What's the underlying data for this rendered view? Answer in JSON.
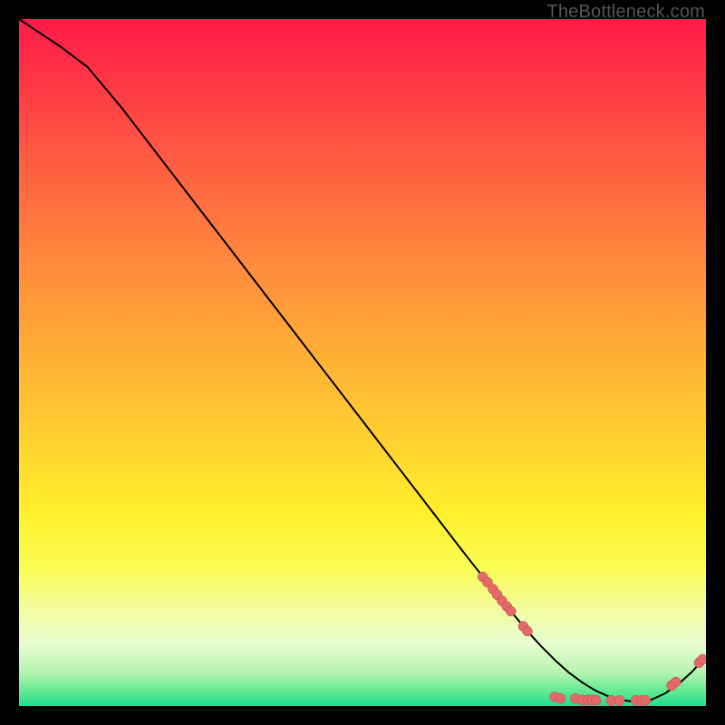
{
  "watermark": "TheBottleneck.com",
  "colors": {
    "curve": "#000000",
    "dot_fill": "#e46a6a",
    "dot_stroke": "#c24a4a"
  },
  "chart_data": {
    "type": "line",
    "title": "",
    "xlabel": "",
    "ylabel": "",
    "xlim": [
      0,
      100
    ],
    "ylim": [
      0,
      100
    ],
    "grid": false,
    "legend": false,
    "series": [
      {
        "name": "curve",
        "x": [
          0,
          3,
          6,
          10,
          15,
          20,
          25,
          30,
          35,
          40,
          45,
          50,
          55,
          60,
          65,
          68,
          70,
          72,
          74,
          76,
          78,
          80,
          82,
          84,
          86,
          88,
          90,
          92,
          94,
          96,
          98,
          100
        ],
        "values": [
          100,
          98,
          96,
          93,
          87,
          80.5,
          74,
          67.5,
          61,
          54.5,
          48,
          41.5,
          35,
          28.5,
          22,
          18.2,
          15.7,
          13.3,
          10.9,
          8.7,
          6.7,
          4.9,
          3.4,
          2.2,
          1.3,
          0.8,
          0.6,
          0.9,
          1.8,
          3.2,
          5.0,
          7.2
        ]
      }
    ],
    "points": [
      {
        "name": "dot-cluster-left",
        "x": 67.5,
        "y": 18.8
      },
      {
        "name": "dot-cluster-left",
        "x": 68.2,
        "y": 18.0
      },
      {
        "name": "dot-cluster-left",
        "x": 69.0,
        "y": 17.0
      },
      {
        "name": "dot-cluster-left",
        "x": 69.6,
        "y": 16.2
      },
      {
        "name": "dot-cluster-left",
        "x": 70.3,
        "y": 15.3
      },
      {
        "name": "dot-cluster-left",
        "x": 71.0,
        "y": 14.5
      },
      {
        "name": "dot-cluster-left",
        "x": 71.6,
        "y": 13.8
      },
      {
        "name": "dot-cluster-left",
        "x": 73.4,
        "y": 11.6
      },
      {
        "name": "dot-cluster-left",
        "x": 74.0,
        "y": 10.9
      },
      {
        "name": "dot-bottom",
        "x": 78.0,
        "y": 1.3
      },
      {
        "name": "dot-bottom",
        "x": 78.8,
        "y": 1.1
      },
      {
        "name": "dot-bottom",
        "x": 81.0,
        "y": 1.1
      },
      {
        "name": "dot-bottom",
        "x": 82.0,
        "y": 0.9
      },
      {
        "name": "dot-bottom",
        "x": 82.8,
        "y": 0.9
      },
      {
        "name": "dot-bottom",
        "x": 83.4,
        "y": 0.9
      },
      {
        "name": "dot-bottom",
        "x": 84.0,
        "y": 0.85
      },
      {
        "name": "dot-bottom",
        "x": 86.2,
        "y": 0.8
      },
      {
        "name": "dot-bottom",
        "x": 87.4,
        "y": 0.8
      },
      {
        "name": "dot-bottom",
        "x": 89.8,
        "y": 0.8
      },
      {
        "name": "dot-bottom",
        "x": 90.6,
        "y": 0.8
      },
      {
        "name": "dot-bottom",
        "x": 91.2,
        "y": 0.8
      },
      {
        "name": "dot-right-rise",
        "x": 95.0,
        "y": 3.0
      },
      {
        "name": "dot-right-rise",
        "x": 95.6,
        "y": 3.5
      },
      {
        "name": "dot-right-rise",
        "x": 99.0,
        "y": 6.3
      },
      {
        "name": "dot-right-rise",
        "x": 99.5,
        "y": 6.8
      }
    ]
  }
}
